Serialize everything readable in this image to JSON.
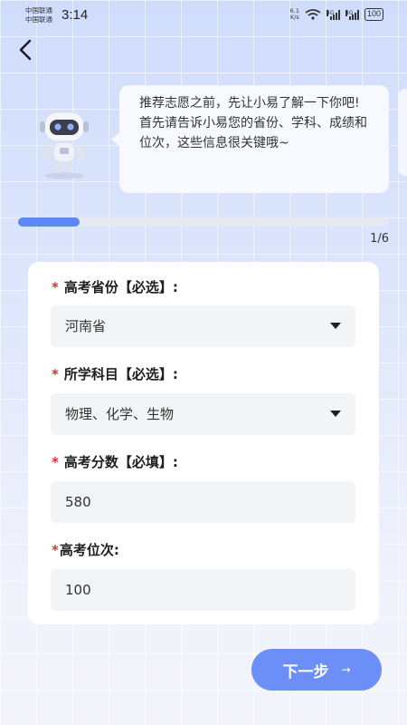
{
  "status_bar": {
    "carrier1": "中国联通",
    "carrier2": "中国联通",
    "time": "3:14",
    "net_speed_value": "6.1",
    "net_speed_unit": "K/s",
    "signal1_label": "4G",
    "signal2_label": "4G",
    "battery": "100"
  },
  "assistant": {
    "message_line1": "推荐志愿之前，先让小易了解一下你吧!",
    "message_line2": "首先请告诉小易您的省份、学科、成绩和位次，这些信息很关键哦~",
    "robot_icon": "robot-icon"
  },
  "progress": {
    "text": "1/6",
    "fraction": 0.1667
  },
  "form": {
    "province": {
      "required_mark": "*",
      "label": "高考省份【必选】:",
      "value": "河南省"
    },
    "subjects": {
      "required_mark": "*",
      "label": "所学科目【必选】:",
      "value": "物理、化学、生物"
    },
    "score": {
      "required_mark": "*",
      "label": "高考分数【必填】:",
      "value": "580"
    },
    "rank": {
      "required_mark": "*",
      "label": "高考位次:",
      "value": "100"
    }
  },
  "next_button": {
    "label": "下一步",
    "arrow": "→"
  },
  "colors": {
    "accent": "#6b8ff7",
    "progress": "#5f86f5",
    "required": "#d9302c"
  }
}
